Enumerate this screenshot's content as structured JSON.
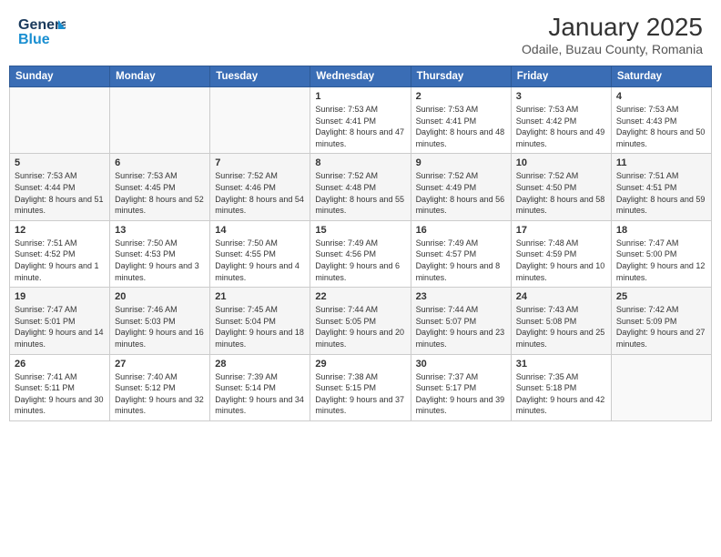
{
  "logo": {
    "line1": "General",
    "line2": "Blue"
  },
  "title": "January 2025",
  "subtitle": "Odaile, Buzau County, Romania",
  "weekdays": [
    "Sunday",
    "Monday",
    "Tuesday",
    "Wednesday",
    "Thursday",
    "Friday",
    "Saturday"
  ],
  "weeks": [
    [
      {
        "day": "",
        "info": ""
      },
      {
        "day": "",
        "info": ""
      },
      {
        "day": "",
        "info": ""
      },
      {
        "day": "1",
        "info": "Sunrise: 7:53 AM\nSunset: 4:41 PM\nDaylight: 8 hours and 47 minutes."
      },
      {
        "day": "2",
        "info": "Sunrise: 7:53 AM\nSunset: 4:41 PM\nDaylight: 8 hours and 48 minutes."
      },
      {
        "day": "3",
        "info": "Sunrise: 7:53 AM\nSunset: 4:42 PM\nDaylight: 8 hours and 49 minutes."
      },
      {
        "day": "4",
        "info": "Sunrise: 7:53 AM\nSunset: 4:43 PM\nDaylight: 8 hours and 50 minutes."
      }
    ],
    [
      {
        "day": "5",
        "info": "Sunrise: 7:53 AM\nSunset: 4:44 PM\nDaylight: 8 hours and 51 minutes."
      },
      {
        "day": "6",
        "info": "Sunrise: 7:53 AM\nSunset: 4:45 PM\nDaylight: 8 hours and 52 minutes."
      },
      {
        "day": "7",
        "info": "Sunrise: 7:52 AM\nSunset: 4:46 PM\nDaylight: 8 hours and 54 minutes."
      },
      {
        "day": "8",
        "info": "Sunrise: 7:52 AM\nSunset: 4:48 PM\nDaylight: 8 hours and 55 minutes."
      },
      {
        "day": "9",
        "info": "Sunrise: 7:52 AM\nSunset: 4:49 PM\nDaylight: 8 hours and 56 minutes."
      },
      {
        "day": "10",
        "info": "Sunrise: 7:52 AM\nSunset: 4:50 PM\nDaylight: 8 hours and 58 minutes."
      },
      {
        "day": "11",
        "info": "Sunrise: 7:51 AM\nSunset: 4:51 PM\nDaylight: 8 hours and 59 minutes."
      }
    ],
    [
      {
        "day": "12",
        "info": "Sunrise: 7:51 AM\nSunset: 4:52 PM\nDaylight: 9 hours and 1 minute."
      },
      {
        "day": "13",
        "info": "Sunrise: 7:50 AM\nSunset: 4:53 PM\nDaylight: 9 hours and 3 minutes."
      },
      {
        "day": "14",
        "info": "Sunrise: 7:50 AM\nSunset: 4:55 PM\nDaylight: 9 hours and 4 minutes."
      },
      {
        "day": "15",
        "info": "Sunrise: 7:49 AM\nSunset: 4:56 PM\nDaylight: 9 hours and 6 minutes."
      },
      {
        "day": "16",
        "info": "Sunrise: 7:49 AM\nSunset: 4:57 PM\nDaylight: 9 hours and 8 minutes."
      },
      {
        "day": "17",
        "info": "Sunrise: 7:48 AM\nSunset: 4:59 PM\nDaylight: 9 hours and 10 minutes."
      },
      {
        "day": "18",
        "info": "Sunrise: 7:47 AM\nSunset: 5:00 PM\nDaylight: 9 hours and 12 minutes."
      }
    ],
    [
      {
        "day": "19",
        "info": "Sunrise: 7:47 AM\nSunset: 5:01 PM\nDaylight: 9 hours and 14 minutes."
      },
      {
        "day": "20",
        "info": "Sunrise: 7:46 AM\nSunset: 5:03 PM\nDaylight: 9 hours and 16 minutes."
      },
      {
        "day": "21",
        "info": "Sunrise: 7:45 AM\nSunset: 5:04 PM\nDaylight: 9 hours and 18 minutes."
      },
      {
        "day": "22",
        "info": "Sunrise: 7:44 AM\nSunset: 5:05 PM\nDaylight: 9 hours and 20 minutes."
      },
      {
        "day": "23",
        "info": "Sunrise: 7:44 AM\nSunset: 5:07 PM\nDaylight: 9 hours and 23 minutes."
      },
      {
        "day": "24",
        "info": "Sunrise: 7:43 AM\nSunset: 5:08 PM\nDaylight: 9 hours and 25 minutes."
      },
      {
        "day": "25",
        "info": "Sunrise: 7:42 AM\nSunset: 5:09 PM\nDaylight: 9 hours and 27 minutes."
      }
    ],
    [
      {
        "day": "26",
        "info": "Sunrise: 7:41 AM\nSunset: 5:11 PM\nDaylight: 9 hours and 30 minutes."
      },
      {
        "day": "27",
        "info": "Sunrise: 7:40 AM\nSunset: 5:12 PM\nDaylight: 9 hours and 32 minutes."
      },
      {
        "day": "28",
        "info": "Sunrise: 7:39 AM\nSunset: 5:14 PM\nDaylight: 9 hours and 34 minutes."
      },
      {
        "day": "29",
        "info": "Sunrise: 7:38 AM\nSunset: 5:15 PM\nDaylight: 9 hours and 37 minutes."
      },
      {
        "day": "30",
        "info": "Sunrise: 7:37 AM\nSunset: 5:17 PM\nDaylight: 9 hours and 39 minutes."
      },
      {
        "day": "31",
        "info": "Sunrise: 7:35 AM\nSunset: 5:18 PM\nDaylight: 9 hours and 42 minutes."
      },
      {
        "day": "",
        "info": ""
      }
    ]
  ]
}
